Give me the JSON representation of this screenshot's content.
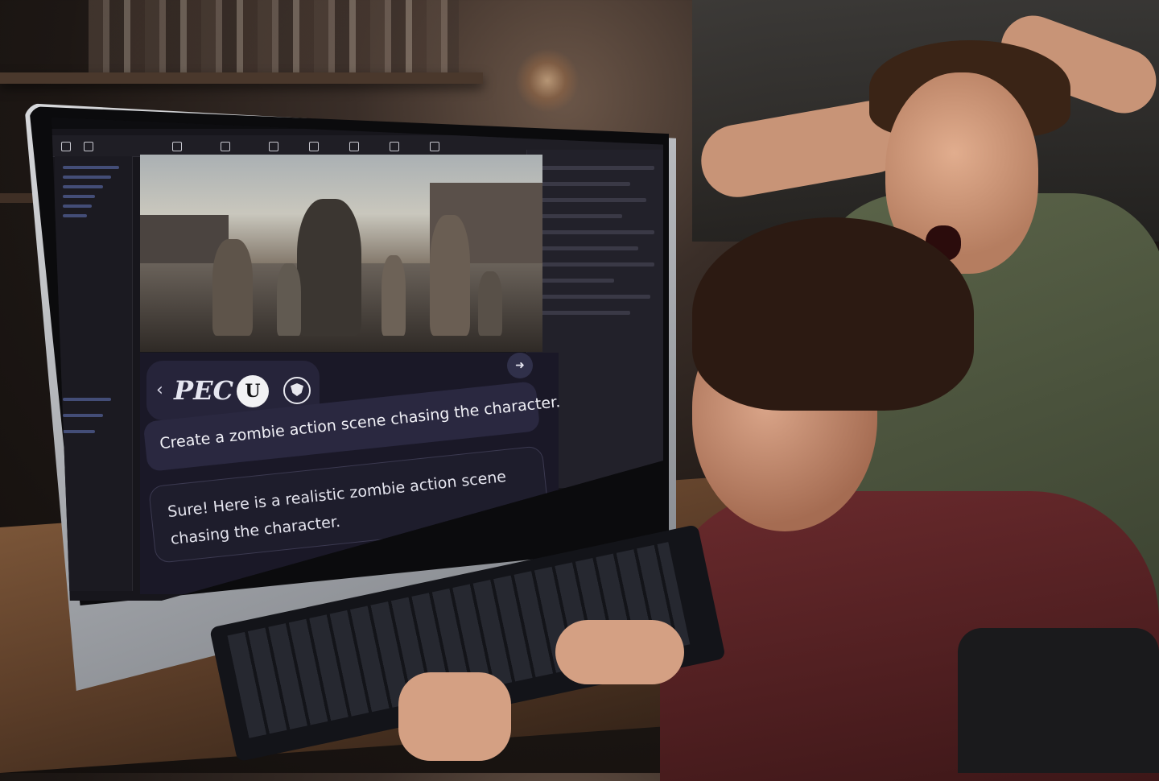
{
  "scene": {
    "description_type": "photo",
    "colors": {
      "screen_bg": "#17161c",
      "chat_bg": "#1a1827",
      "bubble": "#2a2840",
      "accent": "#5f6fb0"
    }
  },
  "chat": {
    "brand_logo_text": "PEC",
    "engine_icon_text": "U",
    "prompt": "Create a zombie action scene chasing the character.",
    "reply": "Sure! Here is a realistic zombie action scene chasing the character."
  },
  "icons": {
    "back": "chevron-left-icon",
    "send": "send-icon",
    "engine": "unreal-engine-icon",
    "shield": "shield-icon",
    "apple": "apple-logo-icon"
  }
}
